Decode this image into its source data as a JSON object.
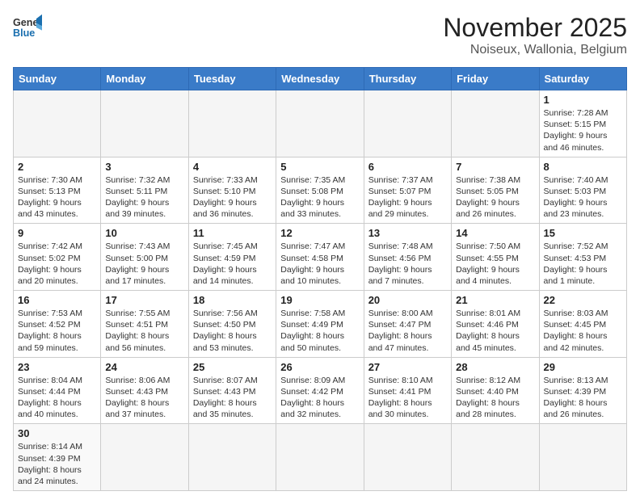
{
  "header": {
    "logo_line1": "General",
    "logo_line2": "Blue",
    "month_title": "November 2025",
    "subtitle": "Noiseux, Wallonia, Belgium"
  },
  "days_of_week": [
    "Sunday",
    "Monday",
    "Tuesday",
    "Wednesday",
    "Thursday",
    "Friday",
    "Saturday"
  ],
  "weeks": [
    [
      {
        "day": "",
        "info": ""
      },
      {
        "day": "",
        "info": ""
      },
      {
        "day": "",
        "info": ""
      },
      {
        "day": "",
        "info": ""
      },
      {
        "day": "",
        "info": ""
      },
      {
        "day": "",
        "info": ""
      },
      {
        "day": "1",
        "info": "Sunrise: 7:28 AM\nSunset: 5:15 PM\nDaylight: 9 hours and 46 minutes."
      }
    ],
    [
      {
        "day": "2",
        "info": "Sunrise: 7:30 AM\nSunset: 5:13 PM\nDaylight: 9 hours and 43 minutes."
      },
      {
        "day": "3",
        "info": "Sunrise: 7:32 AM\nSunset: 5:11 PM\nDaylight: 9 hours and 39 minutes."
      },
      {
        "day": "4",
        "info": "Sunrise: 7:33 AM\nSunset: 5:10 PM\nDaylight: 9 hours and 36 minutes."
      },
      {
        "day": "5",
        "info": "Sunrise: 7:35 AM\nSunset: 5:08 PM\nDaylight: 9 hours and 33 minutes."
      },
      {
        "day": "6",
        "info": "Sunrise: 7:37 AM\nSunset: 5:07 PM\nDaylight: 9 hours and 29 minutes."
      },
      {
        "day": "7",
        "info": "Sunrise: 7:38 AM\nSunset: 5:05 PM\nDaylight: 9 hours and 26 minutes."
      },
      {
        "day": "8",
        "info": "Sunrise: 7:40 AM\nSunset: 5:03 PM\nDaylight: 9 hours and 23 minutes."
      }
    ],
    [
      {
        "day": "9",
        "info": "Sunrise: 7:42 AM\nSunset: 5:02 PM\nDaylight: 9 hours and 20 minutes."
      },
      {
        "day": "10",
        "info": "Sunrise: 7:43 AM\nSunset: 5:00 PM\nDaylight: 9 hours and 17 minutes."
      },
      {
        "day": "11",
        "info": "Sunrise: 7:45 AM\nSunset: 4:59 PM\nDaylight: 9 hours and 14 minutes."
      },
      {
        "day": "12",
        "info": "Sunrise: 7:47 AM\nSunset: 4:58 PM\nDaylight: 9 hours and 10 minutes."
      },
      {
        "day": "13",
        "info": "Sunrise: 7:48 AM\nSunset: 4:56 PM\nDaylight: 9 hours and 7 minutes."
      },
      {
        "day": "14",
        "info": "Sunrise: 7:50 AM\nSunset: 4:55 PM\nDaylight: 9 hours and 4 minutes."
      },
      {
        "day": "15",
        "info": "Sunrise: 7:52 AM\nSunset: 4:53 PM\nDaylight: 9 hours and 1 minute."
      }
    ],
    [
      {
        "day": "16",
        "info": "Sunrise: 7:53 AM\nSunset: 4:52 PM\nDaylight: 8 hours and 59 minutes."
      },
      {
        "day": "17",
        "info": "Sunrise: 7:55 AM\nSunset: 4:51 PM\nDaylight: 8 hours and 56 minutes."
      },
      {
        "day": "18",
        "info": "Sunrise: 7:56 AM\nSunset: 4:50 PM\nDaylight: 8 hours and 53 minutes."
      },
      {
        "day": "19",
        "info": "Sunrise: 7:58 AM\nSunset: 4:49 PM\nDaylight: 8 hours and 50 minutes."
      },
      {
        "day": "20",
        "info": "Sunrise: 8:00 AM\nSunset: 4:47 PM\nDaylight: 8 hours and 47 minutes."
      },
      {
        "day": "21",
        "info": "Sunrise: 8:01 AM\nSunset: 4:46 PM\nDaylight: 8 hours and 45 minutes."
      },
      {
        "day": "22",
        "info": "Sunrise: 8:03 AM\nSunset: 4:45 PM\nDaylight: 8 hours and 42 minutes."
      }
    ],
    [
      {
        "day": "23",
        "info": "Sunrise: 8:04 AM\nSunset: 4:44 PM\nDaylight: 8 hours and 40 minutes."
      },
      {
        "day": "24",
        "info": "Sunrise: 8:06 AM\nSunset: 4:43 PM\nDaylight: 8 hours and 37 minutes."
      },
      {
        "day": "25",
        "info": "Sunrise: 8:07 AM\nSunset: 4:43 PM\nDaylight: 8 hours and 35 minutes."
      },
      {
        "day": "26",
        "info": "Sunrise: 8:09 AM\nSunset: 4:42 PM\nDaylight: 8 hours and 32 minutes."
      },
      {
        "day": "27",
        "info": "Sunrise: 8:10 AM\nSunset: 4:41 PM\nDaylight: 8 hours and 30 minutes."
      },
      {
        "day": "28",
        "info": "Sunrise: 8:12 AM\nSunset: 4:40 PM\nDaylight: 8 hours and 28 minutes."
      },
      {
        "day": "29",
        "info": "Sunrise: 8:13 AM\nSunset: 4:39 PM\nDaylight: 8 hours and 26 minutes."
      }
    ],
    [
      {
        "day": "30",
        "info": "Sunrise: 8:14 AM\nSunset: 4:39 PM\nDaylight: 8 hours and 24 minutes."
      },
      {
        "day": "",
        "info": ""
      },
      {
        "day": "",
        "info": ""
      },
      {
        "day": "",
        "info": ""
      },
      {
        "day": "",
        "info": ""
      },
      {
        "day": "",
        "info": ""
      },
      {
        "day": "",
        "info": ""
      }
    ]
  ]
}
